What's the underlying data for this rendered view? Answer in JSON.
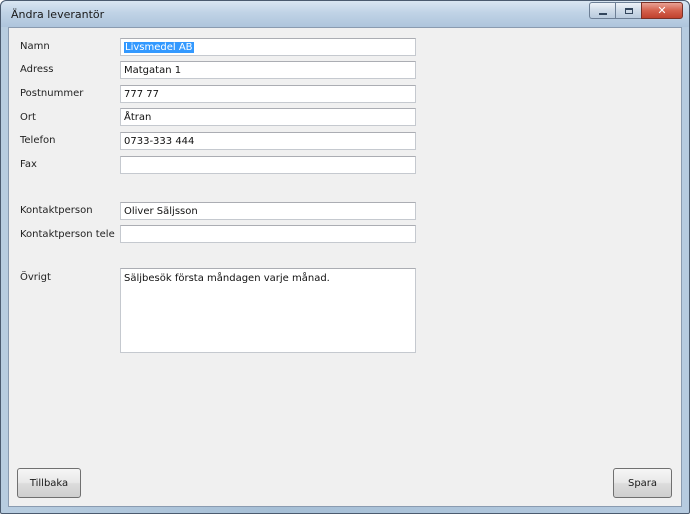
{
  "window": {
    "title": "Ändra leverantör"
  },
  "form": {
    "fields": [
      {
        "label": "Namn",
        "value": "Livsmedel AB"
      },
      {
        "label": "Adress",
        "value": "Matgatan 1"
      },
      {
        "label": "Postnummer",
        "value": "777 77"
      },
      {
        "label": "Ort",
        "value": "Åtran"
      },
      {
        "label": "Telefon",
        "value": "0733-333 444"
      },
      {
        "label": "Fax",
        "value": ""
      },
      {
        "label": "Kontaktperson",
        "value": "Oliver Säljsson"
      },
      {
        "label": "Kontaktperson tele",
        "value": ""
      },
      {
        "label": "Övrigt",
        "value": "Säljbesök första måndagen varje månad."
      }
    ]
  },
  "buttons": {
    "back_label": "Tillbaka",
    "save_label": "Spara"
  },
  "icons": {
    "minimize": "minimize-icon",
    "maximize": "maximize-icon",
    "close": "close-icon"
  }
}
